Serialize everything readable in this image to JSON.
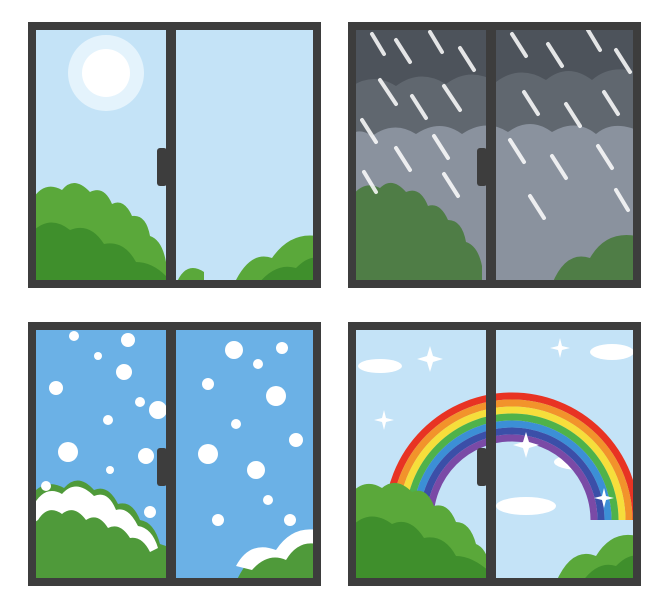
{
  "windows": [
    {
      "name": "sunny",
      "sky_color": "#c4e3f7",
      "foliage_color": "#5aa83a"
    },
    {
      "name": "rainy",
      "sky_color": "#7e8794",
      "foliage_color": "#4f7d46"
    },
    {
      "name": "snowy",
      "sky_color": "#6bb1e6",
      "foliage_color": "#4f9a3a"
    },
    {
      "name": "rainbow",
      "sky_color": "#c4e3f7",
      "foliage_color": "#5aa83a"
    }
  ],
  "colors": {
    "frame": "#3d3d3d",
    "sun": "#ffffff",
    "rainbow": [
      "#e83323",
      "#f2932b",
      "#f6de3b",
      "#4fb24a",
      "#3c8fd6",
      "#3b4fa8",
      "#7a4aa6"
    ]
  }
}
